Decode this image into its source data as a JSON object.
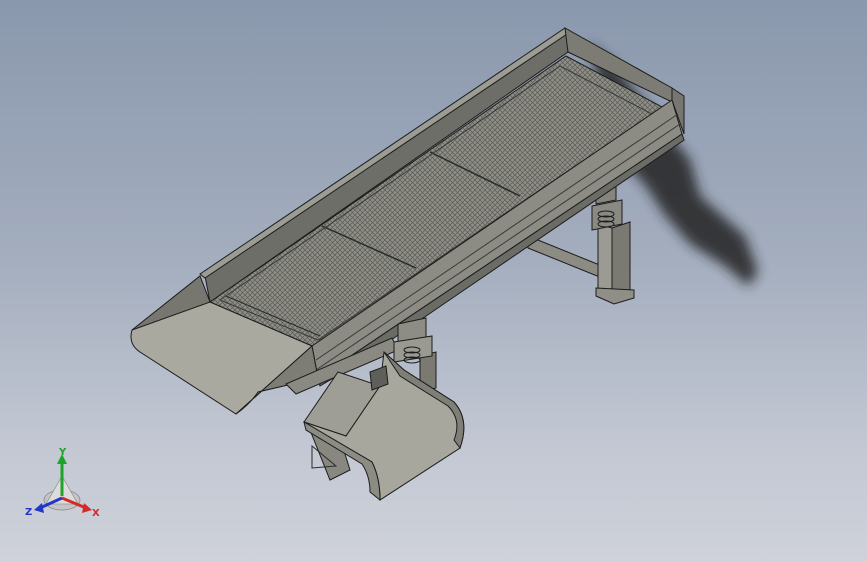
{
  "window": {
    "background_top": "#8a98ad",
    "background_bottom": "#cfd2da"
  },
  "model": {
    "colors": {
      "body": "#8b8b84",
      "body_light": "#a6a69c",
      "body_dark": "#5e5e58",
      "mesh": "#9a9a93",
      "mesh_dark": "#6f6f69",
      "edge": "#1c1c1c",
      "shadow": "#1a1a1a"
    },
    "icons": [
      "coordinate-triad-icon"
    ]
  },
  "triad": {
    "x_label": "X",
    "y_label": "Y",
    "z_label": "Z",
    "x_color": "#d42a2a",
    "y_color": "#1fa32a",
    "z_color": "#2436c8"
  }
}
